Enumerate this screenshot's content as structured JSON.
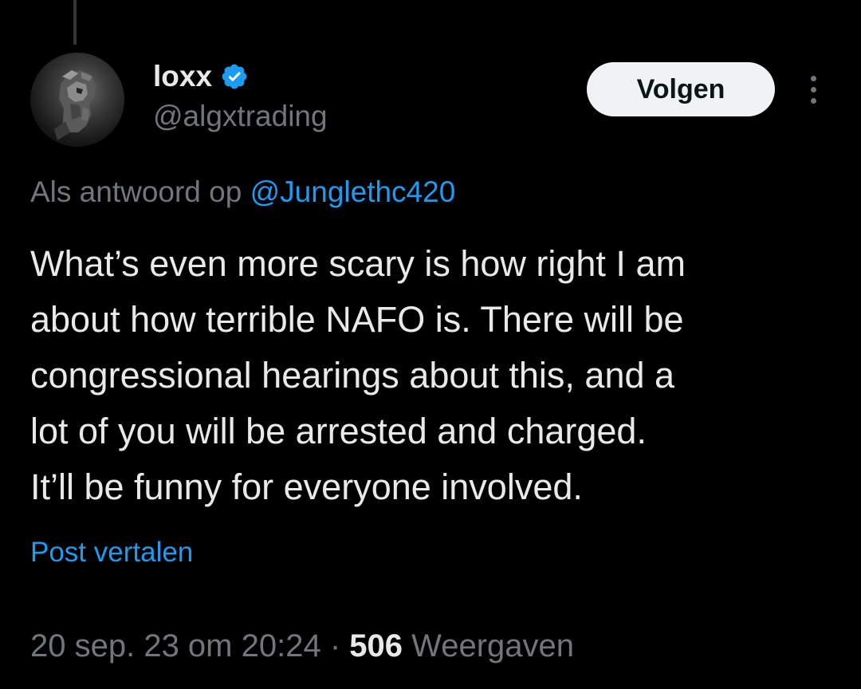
{
  "author": {
    "display_name": "loxx",
    "handle": "@algxtrading",
    "verified": true,
    "verified_color": "#1d9bf0"
  },
  "actions": {
    "follow_label": "Volgen",
    "more_icon": "more-horizontal-icon"
  },
  "reply": {
    "prefix": "Als antwoord op",
    "mention": "@Junglethc420"
  },
  "tweet": {
    "lines": [
      "What’s even more scary is how right I am",
      "about how terrible NAFO is. There will be",
      "congressional hearings about this, and a",
      "lot of you will be arrested and charged.",
      "It’ll be funny for everyone involved."
    ]
  },
  "translate": {
    "label": "Post vertalen"
  },
  "meta": {
    "timestamp": "20 sep. 23 om 20:24",
    "separator": "·",
    "views_count": "506",
    "views_label": "Weergaven"
  },
  "colors": {
    "background": "#000000",
    "text_primary": "#e7e9ea",
    "text_secondary": "#71767b",
    "link": "#1d9bf0"
  }
}
